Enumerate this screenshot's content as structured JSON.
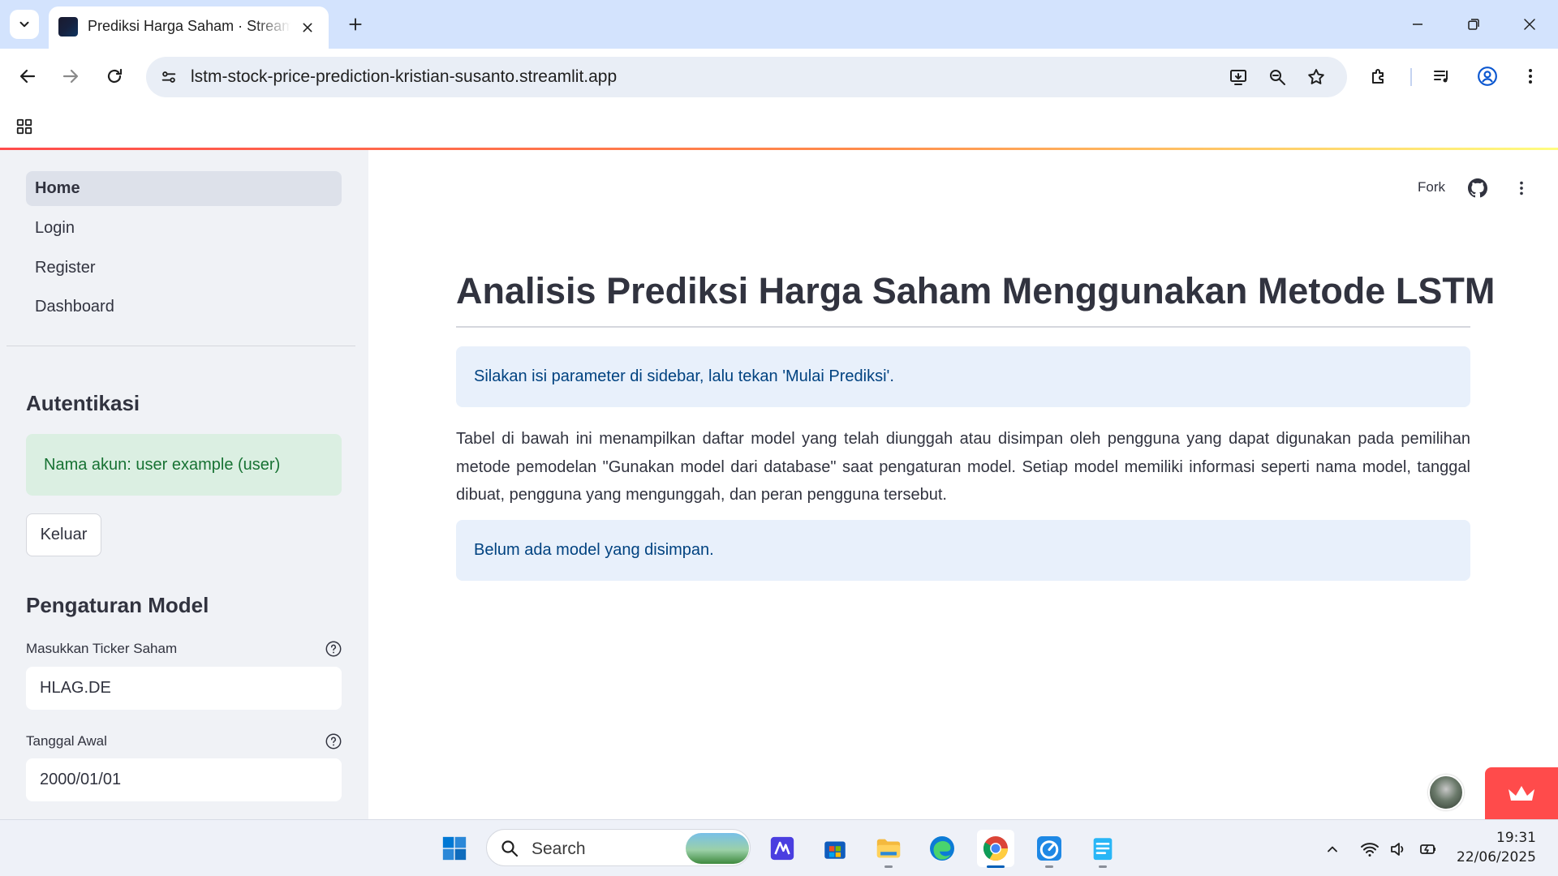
{
  "browser": {
    "tab_title": "Prediksi Harga Saham · Streamlit",
    "url": "lstm-stock-price-prediction-kristian-susanto.streamlit.app"
  },
  "sidebar": {
    "nav": [
      {
        "label": "Home",
        "active": true
      },
      {
        "label": "Login",
        "active": false
      },
      {
        "label": "Register",
        "active": false
      },
      {
        "label": "Dashboard",
        "active": false
      }
    ],
    "auth_heading": "Autentikasi",
    "account_message": "Nama akun: user example (user)",
    "logout_label": "Keluar",
    "settings_heading": "Pengaturan Model",
    "ticker_label": "Masukkan Ticker Saham",
    "ticker_value": "HLAG.DE",
    "start_date_label": "Tanggal Awal",
    "start_date_value": "2000/01/01"
  },
  "header": {
    "fork_label": "Fork"
  },
  "main": {
    "title": "Analisis Prediksi Harga Saham Menggunakan Metode LSTM",
    "info_message": "Silakan isi parameter di sidebar, lalu tekan 'Mulai Prediksi'.",
    "description": "Tabel di bawah ini menampilkan daftar model yang telah diunggah atau disimpan oleh pengguna yang dapat digunakan pada pemilihan metode pemodelan \"Gunakan model dari database\" saat pengaturan model. Setiap model memiliki informasi seperti nama model, tanggal dibuat, pengguna yang mengunggah, dan peran pengguna tersebut.",
    "empty_message": "Belum ada model yang disimpan."
  },
  "taskbar": {
    "search_placeholder": "Search",
    "time": "19:31",
    "date": "22/06/2025"
  },
  "colors": {
    "streamlit_red": "#ff4b4b",
    "info_bg": "#e8f0fb",
    "info_text": "#004280",
    "success_bg": "#dbefe2",
    "success_text": "#177233",
    "sidebar_bg": "#f0f2f6",
    "tab_strip": "#d3e3fd"
  },
  "icons": [
    "tab-search-icon",
    "close-icon",
    "plus-icon",
    "minimize-icon",
    "restore-icon",
    "close-window-icon",
    "back-icon",
    "forward-icon",
    "reload-icon",
    "site-info-icon",
    "install-icon",
    "zoom-icon",
    "star-icon",
    "extensions-icon",
    "media-icon",
    "profile-icon",
    "kebab-icon",
    "apps-icon",
    "help-icon",
    "github-icon",
    "windows-start-icon",
    "search-icon",
    "chevron-up-icon",
    "wifi-icon",
    "volume-icon",
    "battery-icon"
  ]
}
